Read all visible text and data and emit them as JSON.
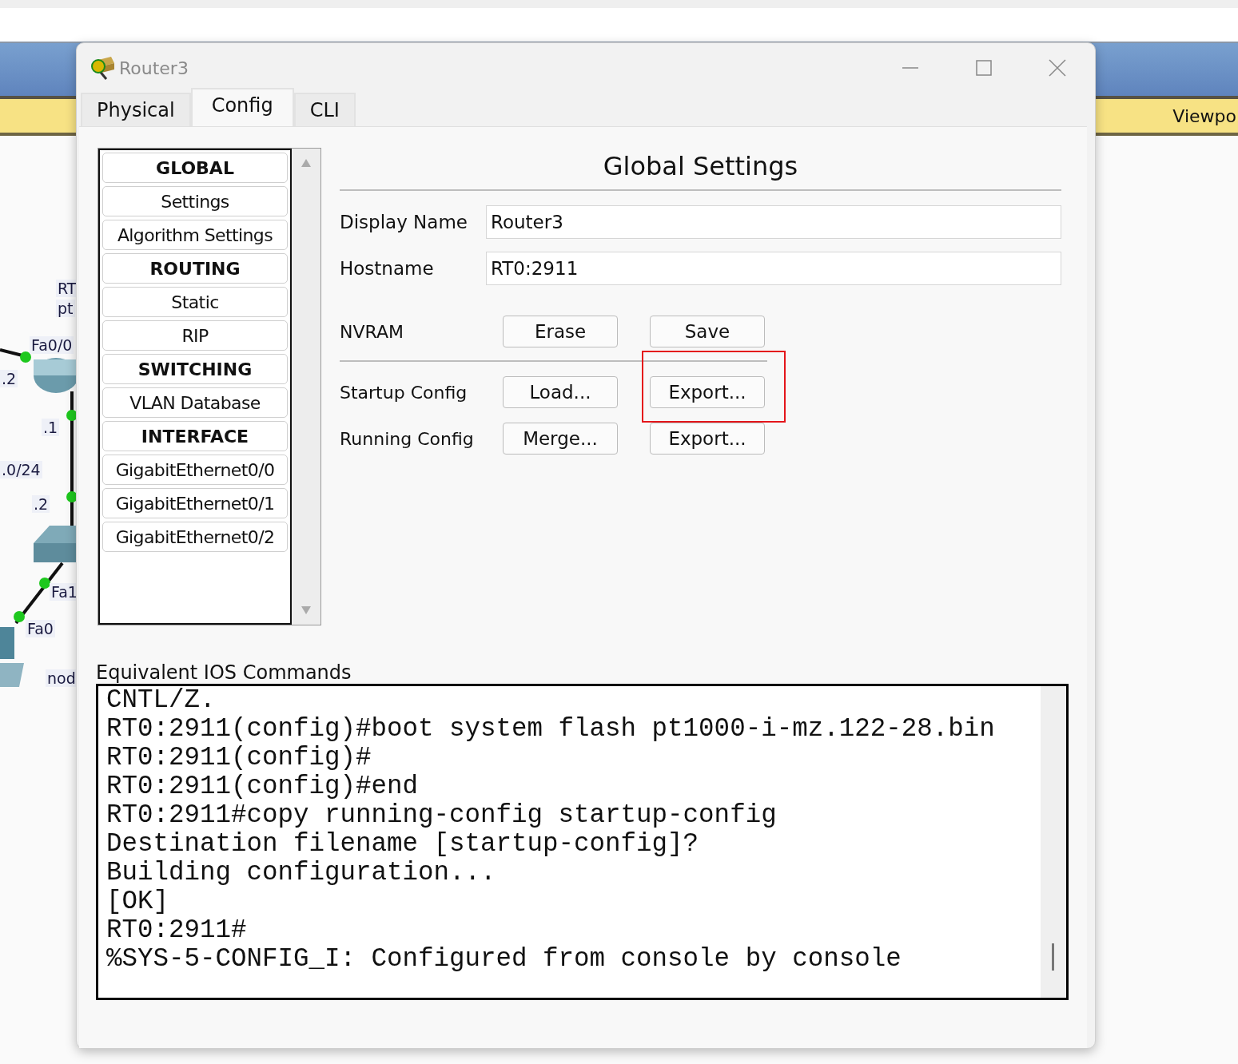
{
  "background_app": {
    "toolbar_text": "Viewpo",
    "canvas_labels": [
      {
        "text": "RT"
      },
      {
        "text": "pt"
      },
      {
        "text": "Fa0/0"
      },
      {
        "text": ".2"
      },
      {
        "text": ".1"
      },
      {
        "text": ".0/24"
      },
      {
        "text": ".2"
      },
      {
        "text": "Fa1"
      },
      {
        "text": "Fa0"
      },
      {
        "text": "nod"
      }
    ]
  },
  "window": {
    "title": "Router3"
  },
  "tabs": [
    {
      "label": "Physical",
      "selected": false
    },
    {
      "label": "Config",
      "selected": true
    },
    {
      "label": "CLI",
      "selected": false
    }
  ],
  "sidebar": {
    "items": [
      {
        "label": "GLOBAL",
        "kind": "header"
      },
      {
        "label": "Settings",
        "kind": "item"
      },
      {
        "label": "Algorithm Settings",
        "kind": "item"
      },
      {
        "label": "ROUTING",
        "kind": "header"
      },
      {
        "label": "Static",
        "kind": "item"
      },
      {
        "label": "RIP",
        "kind": "item"
      },
      {
        "label": "SWITCHING",
        "kind": "header"
      },
      {
        "label": "VLAN Database",
        "kind": "item"
      },
      {
        "label": "INTERFACE",
        "kind": "header"
      },
      {
        "label": "GigabitEthernet0/0",
        "kind": "item"
      },
      {
        "label": "GigabitEthernet0/1",
        "kind": "item"
      },
      {
        "label": "GigabitEthernet0/2",
        "kind": "item"
      }
    ]
  },
  "panel": {
    "title": "Global Settings",
    "fields": [
      {
        "label": "Display Name",
        "value": "Router3"
      },
      {
        "label": "Hostname",
        "value": "RT0:2911"
      }
    ],
    "rows": [
      {
        "label": "NVRAM",
        "buttons": [
          {
            "label": "Erase",
            "highlighted": false
          },
          {
            "label": "Save",
            "highlighted": false
          }
        ]
      },
      {
        "label": "Startup Config",
        "buttons": [
          {
            "label": "Load...",
            "highlighted": false
          },
          {
            "label": "Export...",
            "highlighted": true
          }
        ]
      },
      {
        "label": "Running Config",
        "buttons": [
          {
            "label": "Merge...",
            "highlighted": false
          },
          {
            "label": "Export...",
            "highlighted": false
          }
        ]
      }
    ]
  },
  "ios": {
    "label": "Equivalent IOS Commands",
    "lines": [
      "CNTL/Z.",
      "RT0:2911(config)#boot system flash pt1000-i-mz.122-28.bin",
      "RT0:2911(config)#",
      "RT0:2911(config)#end",
      "RT0:2911#copy running-config startup-config",
      "Destination filename [startup-config]?",
      "Building configuration...",
      "[OK]",
      "RT0:2911#",
      "%SYS-5-CONFIG_I: Configured from console by console"
    ]
  }
}
